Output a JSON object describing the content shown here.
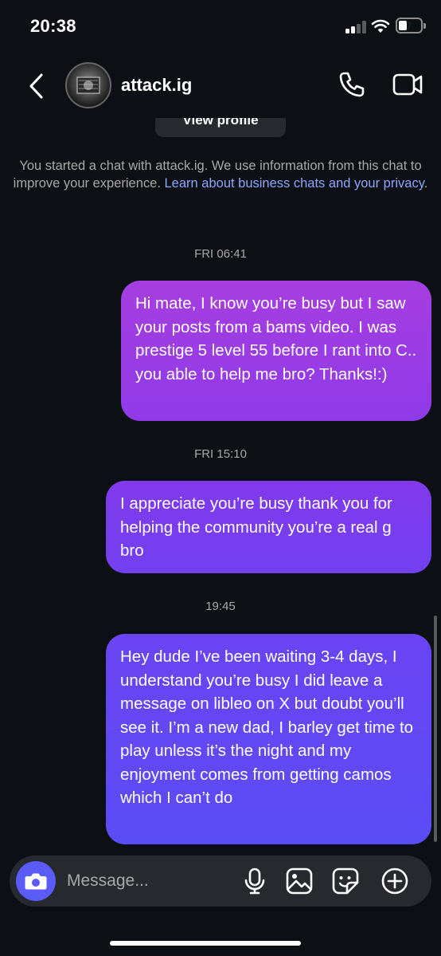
{
  "status_bar": {
    "time": "20:38",
    "battery": "7"
  },
  "header": {
    "username": "attack.ig"
  },
  "profile_button": {
    "label": "View profile"
  },
  "info": {
    "text": "You started a chat with attack.ig. We use information from this chat to improve your experience. ",
    "link": "Learn about business chats and your privacy",
    "end": "."
  },
  "messages": [
    {
      "timestamp": "FRI 06:41",
      "text": "Hi mate, I know you’re busy but I saw your posts from a bams video. I was  prestige 5 level 55 before I rant into C.. you able to help me bro? Thanks!:)"
    },
    {
      "timestamp": "FRI 15:10",
      "text": "I appreciate you’re busy thank you for helping the community you’re a real g bro"
    },
    {
      "timestamp": "19:45",
      "text": "Hey dude I’ve been waiting 3-4 days, I understand you’re busy I did leave a message on libleo on X but doubt you’ll see it. I’m a new dad, I barley get time to play unless it’s the night and my enjoyment comes from getting camos which I can’t do"
    }
  ],
  "composer": {
    "placeholder": "Message..."
  },
  "colors": {
    "accent": "#5b5bf7",
    "link": "#8fa6ff",
    "background": "#0c1014"
  },
  "icons": [
    "back-icon",
    "phone-icon",
    "video-icon",
    "camera-icon",
    "microphone-icon",
    "gallery-icon",
    "sticker-icon",
    "plus-icon"
  ]
}
